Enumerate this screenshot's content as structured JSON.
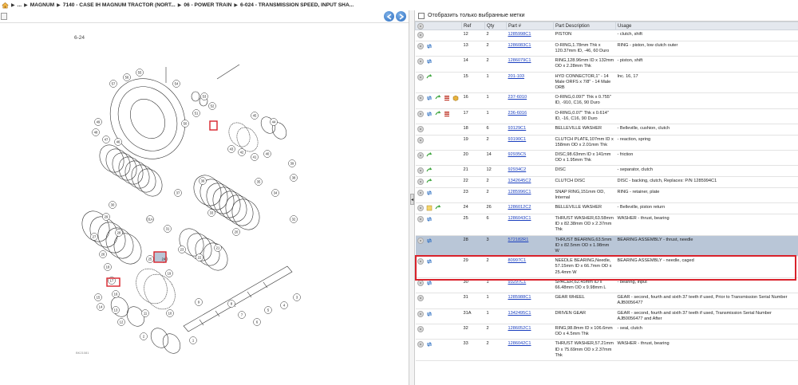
{
  "breadcrumb": {
    "items": [
      "...",
      "MAGNUM",
      "7140 - CASE IH MAGNUM TRACTOR (NORT...",
      "06 - POWER TRAIN",
      "6-024 - TRANSMISSION SPEED, INPUT SHA..."
    ]
  },
  "diagram": {
    "title": "6-24",
    "caption": "BK21081"
  },
  "filter": {
    "label": "Отобразить только выбранные метки"
  },
  "table": {
    "columns": [
      "Ref",
      "Qty",
      "Part #",
      "Part Description",
      "Usage"
    ],
    "rows": [
      {
        "icons": [
          "circle"
        ],
        "ref": "12",
        "qty": "2",
        "part": "1285998C1",
        "desc": "PISTON",
        "usage": "- clutch, shift"
      },
      {
        "icons": [
          "circle",
          "arrows"
        ],
        "ref": "13",
        "qty": "2",
        "part": "1286083C1",
        "desc": "O-RING,1.78mm Thk x 120.37mm ID, -46, 60 Duro",
        "usage": "RING - piston, low clutch outer"
      },
      {
        "icons": [
          "circle",
          "arrows"
        ],
        "ref": "14",
        "qty": "2",
        "part": "1286079C1",
        "desc": "RING,128.96mm ID x 132mm OD x 2.28mm Thk",
        "usage": "- piston, shift"
      },
      {
        "icons": [
          "circle",
          "green"
        ],
        "ref": "15",
        "qty": "1",
        "part": "201-103",
        "desc": "HYD CONNECTOR,1\" - 14 Male ORFS x 7/8\" - 14 Male ORB",
        "usage": "Inc. 16, 17"
      },
      {
        "icons": [
          "circle",
          "arrows",
          "green",
          "flag",
          "cube"
        ],
        "ref": "16",
        "qty": "1",
        "part": "237-6010",
        "desc": "O-RING,0.097\" Thk x 0.755\" ID, -910, C16, 90 Duro",
        "usage": ""
      },
      {
        "icons": [
          "circle",
          "arrows",
          "green",
          "flag"
        ],
        "ref": "17",
        "qty": "1",
        "part": "236-6016",
        "desc": "O-RING,0.07\" Thk x 0.614\" ID, -16, C16, 90 Duro",
        "usage": ""
      },
      {
        "icons": [
          "circle"
        ],
        "ref": "18",
        "qty": "6",
        "part": "93129C1",
        "desc": "BELLEVILLE WASHER",
        "usage": "- Belleville, cushion, clutch"
      },
      {
        "icons": [
          "circle"
        ],
        "ref": "19",
        "qty": "2",
        "part": "93190C1",
        "desc": "CLUTCH PLATE,107mm ID x 158mm OD x 2.01mm Thk",
        "usage": "- reaction, spring"
      },
      {
        "icons": [
          "circle",
          "green"
        ],
        "ref": "20",
        "qty": "14",
        "part": "92935C5",
        "desc": "DISC,98.63mm ID x 141mm OD x 1.95mm Thk",
        "usage": "- friction"
      },
      {
        "icons": [
          "circle",
          "green"
        ],
        "ref": "21",
        "qty": "12",
        "part": "92934C2",
        "desc": "DISC",
        "usage": "- separator, clutch"
      },
      {
        "icons": [
          "circle",
          "green"
        ],
        "ref": "22",
        "qty": "2",
        "part": "1342645C2",
        "desc": "CLUTCH DISC",
        "usage": "DISC - backing, clutch, Replaces: P/N 1285994C1"
      },
      {
        "icons": [
          "circle",
          "arrows"
        ],
        "ref": "23",
        "qty": "2",
        "part": "1285996C1",
        "desc": "SNAP RING,151mm OD, Internal",
        "usage": "RING - retainer, plate"
      },
      {
        "icons": [
          "circle",
          "note",
          "green"
        ],
        "ref": "24",
        "qty": "26",
        "part": "1286012C2",
        "desc": "BELLEVILLE WASHER",
        "usage": "- Belleville, piston return"
      },
      {
        "icons": [
          "circle",
          "arrows"
        ],
        "ref": "25",
        "qty": "6",
        "part": "1286043C1",
        "desc": "THRUST WASHER,63.58mm ID x 82.38mm OD x 2.37mm Thk",
        "usage": "WASHER - thrust, bearing"
      },
      {
        "icons": [
          "circle",
          "arrows"
        ],
        "ref": "28",
        "qty": "3",
        "part": "572182R1",
        "desc": "THRUST BEARING,63.5mm ID x 82.5mm OD x 1.98mm W",
        "usage": "BEARING ASSEMBLY - thrust, needle",
        "selected": true
      },
      {
        "icons": [
          "circle",
          "arrows"
        ],
        "ref": "29",
        "qty": "2",
        "part": "80997C1",
        "desc": "NEEDLE BEARING,Needle, 57.15mm ID x 66.7mm OD x 25.4mm W",
        "usage": "BEARING ASSEMBLY - needle, caged"
      },
      {
        "icons": [
          "circle",
          "arrows"
        ],
        "ref": "30",
        "qty": "1",
        "part": "93297C1",
        "desc": "SPACER,62.45mm ID x 66.48mm OD x 9.98mm L",
        "usage": "- bearing, input"
      },
      {
        "icons": [
          "circle"
        ],
        "ref": "31",
        "qty": "1",
        "part": "1285988C1",
        "desc": "GEAR WHEEL",
        "usage": "GEAR - second, fourth and sixth 37 teeth if used, Prior to Transmission Serial Number AJB0056477"
      },
      {
        "icons": [
          "circle",
          "arrows"
        ],
        "ref": "31A",
        "qty": "1",
        "part": "1342495C1",
        "desc": "DRIVEN GEAR",
        "usage": "GEAR - second, fourth and sixth 37 teeth if used, Transmission Serial Number AJB0056477 and After"
      },
      {
        "icons": [
          "circle"
        ],
        "ref": "32",
        "qty": "2",
        "part": "1286052C1",
        "desc": "RING,98.8mm ID x 106.6mm OD x 4.5mm Thk",
        "usage": "- seal, clutch"
      },
      {
        "icons": [
          "circle",
          "arrows"
        ],
        "ref": "33",
        "qty": "2",
        "part": "1286042C1",
        "desc": "THRUST WASHER,57.21mm ID x 75.69mm OD x 2.37mm Thk",
        "usage": "WASHER - thrust, bearing"
      }
    ]
  },
  "diagram_labels": [
    "57",
    "56",
    "55",
    "54",
    "53",
    "52",
    "51",
    "50",
    "49",
    "48",
    "47",
    "46",
    "45",
    "44",
    "43",
    "42",
    "41",
    "40",
    "39",
    "38",
    "37",
    "36",
    "35",
    "34",
    "33",
    "32",
    "31",
    "31A",
    "30",
    "29",
    "28",
    "27",
    "26",
    "25",
    "24",
    "23",
    "22",
    "21",
    "20",
    "19",
    "18",
    "17",
    "16",
    "15",
    "14",
    "13",
    "12",
    "11",
    "10",
    "9",
    "8",
    "7",
    "6",
    "5",
    "4",
    "3",
    "2",
    "1"
  ]
}
